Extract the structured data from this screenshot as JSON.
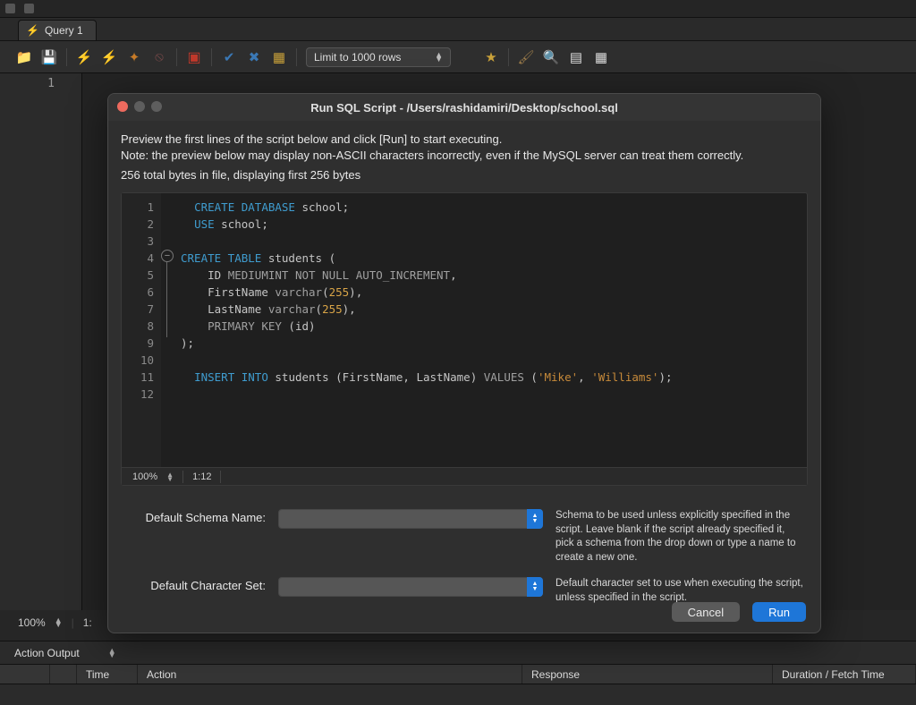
{
  "menubar": {
    "icons": [
      "menu-icon",
      "panel-icon"
    ]
  },
  "tabs": [
    {
      "icon": "bolt-icon",
      "label": "Query 1"
    }
  ],
  "toolbar": {
    "buttons_left": [
      "open-file-icon",
      "save-icon",
      "separator",
      "execute-icon",
      "execute-current-icon",
      "explain-icon",
      "stop-icon",
      "separator",
      "toggle-autocommit-icon",
      "separator",
      "commit-icon",
      "rollback-icon",
      "separator",
      "format-icon"
    ],
    "limit_label": "Limit to 1000 rows",
    "buttons_right": [
      "favorite-icon",
      "separator",
      "brush-icon",
      "search-icon",
      "snippets-icon",
      "tile-icon"
    ]
  },
  "bg_editor": {
    "lines": [
      "1"
    ]
  },
  "bg_status": {
    "zoom": "100%",
    "pos": "1:"
  },
  "action_output": {
    "header": "Action Output",
    "columns": [
      "",
      "",
      "Time",
      "Action",
      "Response",
      "Duration / Fetch Time"
    ]
  },
  "modal": {
    "title": "Run SQL Script - /Users/rashidamiri/Desktop/school.sql",
    "preview_line1": "Preview the first lines of the script below and click [Run] to start executing.",
    "preview_line2": "Note: the preview below may display non-ASCII characters incorrectly, even if the MySQL server can treat them correctly.",
    "bytes_text": "256 total bytes in file, displaying first 256 bytes",
    "code_lines": [
      {
        "n": 1,
        "tokens": [
          [
            "kw",
            "CREATE DATABASE"
          ],
          [
            "pn",
            " "
          ],
          [
            "id",
            "school"
          ],
          [
            "pn",
            ";"
          ]
        ]
      },
      {
        "n": 2,
        "tokens": [
          [
            "kw",
            "USE"
          ],
          [
            "pn",
            " "
          ],
          [
            "id",
            "school"
          ],
          [
            "pn",
            ";"
          ]
        ]
      },
      {
        "n": 3,
        "tokens": []
      },
      {
        "n": 4,
        "tokens": [
          [
            "kw",
            "CREATE TABLE"
          ],
          [
            "pn",
            " "
          ],
          [
            "id",
            "students"
          ],
          [
            "pn",
            " ("
          ]
        ],
        "fold_start": true
      },
      {
        "n": 5,
        "tokens": [
          [
            "pn",
            "    "
          ],
          [
            "id",
            "ID"
          ],
          [
            "pn",
            " "
          ],
          [
            "fn",
            "MEDIUMINT NOT NULL AUTO_INCREMENT"
          ],
          [
            "pn",
            ","
          ]
        ]
      },
      {
        "n": 6,
        "tokens": [
          [
            "pn",
            "    "
          ],
          [
            "id",
            "FirstName"
          ],
          [
            "pn",
            " "
          ],
          [
            "fn",
            "varchar"
          ],
          [
            "pn",
            "("
          ],
          [
            "num",
            "255"
          ],
          [
            "pn",
            "),"
          ]
        ]
      },
      {
        "n": 7,
        "tokens": [
          [
            "pn",
            "    "
          ],
          [
            "id",
            "LastName"
          ],
          [
            "pn",
            " "
          ],
          [
            "fn",
            "varchar"
          ],
          [
            "pn",
            "("
          ],
          [
            "num",
            "255"
          ],
          [
            "pn",
            "),"
          ]
        ]
      },
      {
        "n": 8,
        "tokens": [
          [
            "pn",
            "    "
          ],
          [
            "fn",
            "PRIMARY KEY"
          ],
          [
            "pn",
            " ("
          ],
          [
            "id",
            "id"
          ],
          [
            "pn",
            ")"
          ]
        ]
      },
      {
        "n": 9,
        "tokens": [
          [
            "pn",
            ");"
          ]
        ],
        "fold_end": true
      },
      {
        "n": 10,
        "tokens": []
      },
      {
        "n": 11,
        "tokens": [
          [
            "kw",
            "INSERT INTO"
          ],
          [
            "pn",
            " "
          ],
          [
            "id",
            "students"
          ],
          [
            "pn",
            " ("
          ],
          [
            "id",
            "FirstName"
          ],
          [
            "pn",
            ", "
          ],
          [
            "id",
            "LastName"
          ],
          [
            "pn",
            ") "
          ],
          [
            "fn",
            "VALUES"
          ],
          [
            "pn",
            " ("
          ],
          [
            "str",
            "'Mike'"
          ],
          [
            "pn",
            ", "
          ],
          [
            "str",
            "'Williams'"
          ],
          [
            "pn",
            ");"
          ]
        ]
      },
      {
        "n": 12,
        "tokens": []
      }
    ],
    "code_status": {
      "zoom": "100%",
      "pos": "1:12"
    },
    "form": {
      "schema_label": "Default Schema Name:",
      "schema_help": "Schema to be used unless explicitly specified in the script. Leave blank if the script already specified it,\npick a schema from the drop down or type a name to create a new one.",
      "charset_label": "Default Character Set:",
      "charset_help": "Default character set to use when executing the script, unless specified in the script."
    },
    "buttons": {
      "cancel": "Cancel",
      "run": "Run"
    }
  }
}
